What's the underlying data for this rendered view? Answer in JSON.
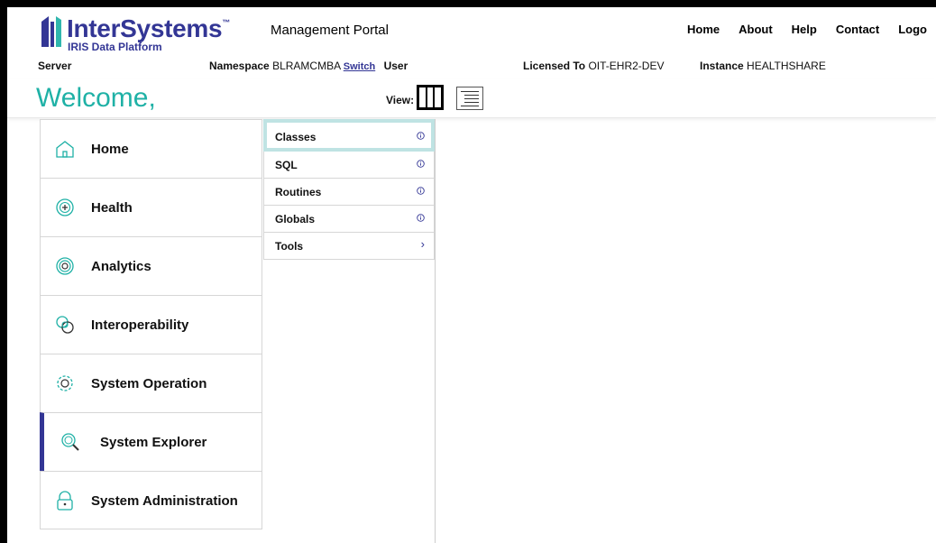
{
  "brand": {
    "name": "InterSystems",
    "tm": "™",
    "subtitle": "IRIS Data Platform",
    "color": "#333695"
  },
  "header": {
    "portal_title": "Management Portal",
    "nav": [
      "Home",
      "About",
      "Help",
      "Contact",
      "Logo"
    ]
  },
  "infobar": {
    "server_label": "Server",
    "namespace_label": "Namespace",
    "namespace_value": "BLRAMCMBA",
    "switch_label": "Switch",
    "user_label": "User",
    "licensed_label": "Licensed To",
    "licensed_value": "OIT-EHR2-DEV",
    "instance_label": "Instance",
    "instance_value": "HEALTHSHARE"
  },
  "welcome": {
    "text": "Welcome,",
    "color": "#1fb1a6"
  },
  "view": {
    "label": "View:",
    "options": [
      "columns-view-icon",
      "list-view-icon"
    ],
    "selected": "columns-view-icon"
  },
  "menu": {
    "items": [
      {
        "label": "Home",
        "icon": "home-icon"
      },
      {
        "label": "Health",
        "icon": "health-icon"
      },
      {
        "label": "Analytics",
        "icon": "analytics-icon"
      },
      {
        "label": "Interoperability",
        "icon": "interoperability-icon"
      },
      {
        "label": "System Operation",
        "icon": "gear-icon"
      },
      {
        "label": "System Explorer",
        "icon": "search-icon"
      },
      {
        "label": "System Administration",
        "icon": "lock-icon"
      }
    ],
    "active": "System Explorer",
    "active_color": "#333695"
  },
  "submenu": {
    "items": [
      {
        "label": "Classes",
        "icon": "info-icon"
      },
      {
        "label": "SQL",
        "icon": "info-icon"
      },
      {
        "label": "Routines",
        "icon": "info-icon"
      },
      {
        "label": "Globals",
        "icon": "info-icon"
      },
      {
        "label": "Tools",
        "icon": "chevron-right-icon",
        "glyph": "›"
      }
    ],
    "active": "Classes",
    "active_border_color": "#bfe3e3"
  }
}
